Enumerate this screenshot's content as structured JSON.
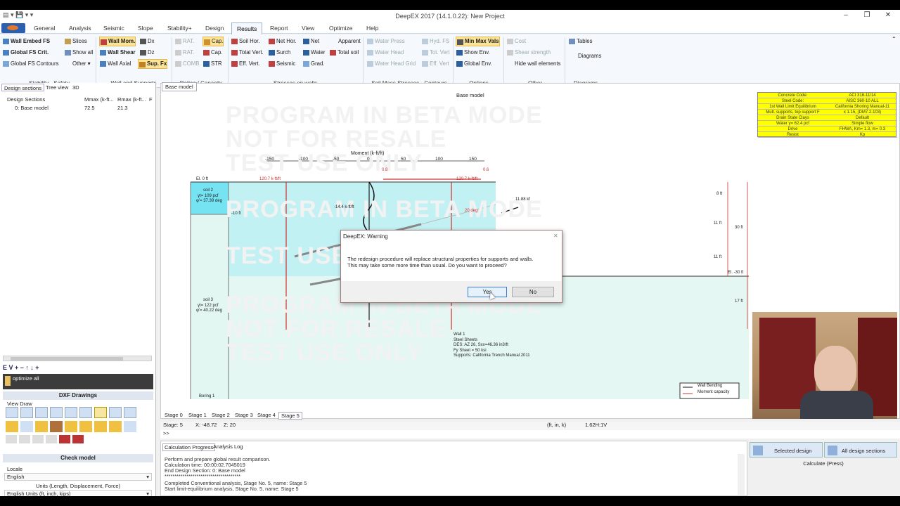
{
  "window": {
    "title": "DeepEX 2017  (14.1.0.22): New Project",
    "min": "–",
    "max": "❐",
    "close": "✕"
  },
  "menu": [
    "General",
    "Analysis",
    "Seismic",
    "Slope",
    "Stability+",
    "Design",
    "Results",
    "Report",
    "View",
    "Optimize",
    "Help"
  ],
  "menu_active": "Results",
  "ribbon": {
    "groups": [
      "Stability - Safety",
      "Wall and Supports",
      "Ratios / Capacity",
      "Stresses on walls",
      "Soil Mass Stresses - Contours",
      "Options",
      "Other",
      "Diagrams"
    ],
    "stability": [
      "Wall Embed FS",
      "Global FS Crit.",
      "Global FS Contours",
      "Slices",
      "Show all",
      "Other"
    ],
    "wall": [
      "Wall Mom.",
      "Dx",
      "Wall Shear",
      "Dz",
      "Wall Axial",
      "Sup. Fx"
    ],
    "ratios": [
      "RAT.",
      "Cap.",
      "RAT.",
      "Cap.",
      "COMB.",
      "STR"
    ],
    "stresses": [
      "Soil Hor.",
      "Net Hor.",
      "Net",
      "Apparent",
      "Total Vert.",
      "Surch",
      "Water",
      "Total soil",
      "Eff. Vert.",
      "Seismic",
      "Grad."
    ],
    "contours": [
      "Water Press",
      "Hyd. FS",
      "Water Head",
      "Tot. Vert",
      "Water Head Grid",
      "Eff. Vert"
    ],
    "options": [
      "Min Max Vals",
      "Show Env.",
      "Global Env."
    ],
    "other": [
      "Cost",
      "Shear strength",
      "Hide wall elements"
    ],
    "diagrams": [
      "Tables",
      "Diagrams"
    ]
  },
  "left": {
    "tabs": [
      "Design sections",
      "Tree view",
      "3D"
    ],
    "grid_head": [
      "Design Sections",
      "Mmax (k-ft...",
      "Rmax (k-ft...",
      "F"
    ],
    "row": [
      "0: Base model",
      "72.5",
      "21.3"
    ],
    "toolbar": "E  V  +  –  ↑  ↓  +",
    "optimize": "optimize all",
    "dxf": "DXF Drawings",
    "viewdraw": "View Draw",
    "check": "Check model",
    "locale_label": "Locale",
    "locale_value": "English",
    "units_label": "Units (Length, Displacement, Force)",
    "units_value": "English Units (ft, inch, kips)"
  },
  "canvas": {
    "tab": "Base model",
    "title": "Base model",
    "watermark": [
      "PROGRAM IN BETA MODE",
      "NOT FOR RESALE",
      "TEST USE ONLY"
    ],
    "moment_axis": "Moment (k-ft/ft)",
    "ticks": [
      "-150",
      "-100",
      "-50",
      "0",
      "50",
      "100",
      "150"
    ],
    "labels": {
      "el0": "El. 0 ft",
      "soil2": "soil 2",
      "soil2a": "γt= 109 pcf",
      "soil2b": "φ'= 37.39 deg",
      "soil3": "soil 3",
      "soil3a": "γt= 122 pcf",
      "soil3b": "φ'= 40.22 deg",
      "m10": "-10 ft",
      "mom1": "-14.4 k-ft/ft",
      "m120a": "120.7 k-ft/ft",
      "m120b": "120.7 k-ft/ft",
      "v08": "0.8",
      "v06": "0.6",
      "kf": "11.88 kf",
      "deg": "20 deg",
      "boring": "Boring 1",
      "el30": "El. -30 ft",
      "d8": "8 ft",
      "d11": "11 ft",
      "d30": "30 ft",
      "d11b": "11 ft",
      "d17": "17 ft"
    },
    "wall_info": [
      "Wall 1",
      "Steel Sheets",
      "DES: AZ 26, Sxx=46.36 in3/ft",
      "Fy Sheet = 50 ksi",
      "Supports: California Trench Manual 2011"
    ],
    "legend": [
      "Wall Bending",
      "Moment capacity"
    ]
  },
  "design_table": [
    [
      "Concrete Code:",
      "ACI 318-11/14"
    ],
    [
      "Steel Code:",
      "AISC 360-10 ALL"
    ],
    [
      "1st Wall Limit Equilibrium",
      "California Shoring Manual-11"
    ],
    [
      "Mult. supports, top support F",
      "x 1.15, (DM7.2-103)"
    ],
    [
      "Drain State Clays",
      "Default"
    ],
    [
      "Water γ= 62.4 pcf",
      "Simple flow"
    ],
    [
      "Drive",
      "FHWA, Km= 1.3, m= 0.3"
    ],
    [
      "Resist",
      "Kp"
    ]
  ],
  "stages": [
    "Stage 0",
    "Stage 1",
    "Stage 2",
    "Stage 3",
    "Stage 4",
    "Stage 5"
  ],
  "stage_active": "Stage 5",
  "status": {
    "stage": "Stage: 5",
    "x": "X: -48.72",
    "z": "Z: 20",
    "units": "(ft, in, k)",
    "scale": "1.62H:1V",
    "cmd": ">>"
  },
  "bottom": {
    "tabs": [
      "Calculation Progress",
      "Analysis Log"
    ],
    "log": [
      "Perform and prepare global result comparison.",
      "Calculation time: 00:00:02.7045019",
      "End Design Section: 0: Base model",
      "**************************************",
      "Completed Conventional analysis, Stage No. 5, name: Stage 5",
      "Start limit-equilibrium analysis, Stage No. 5, name: Stage 5"
    ],
    "selected": "Selected design",
    "all": "All design sections",
    "calc": "Calculate (Press)"
  },
  "dialog": {
    "title": "DeepEX: Warning",
    "message1": "The redesign procedure will replace structural properties for supports and walls.",
    "message2": "This may take some more time than usual. Do you want to proceed?",
    "yes": "Yes",
    "no": "No",
    "close": "✕"
  }
}
